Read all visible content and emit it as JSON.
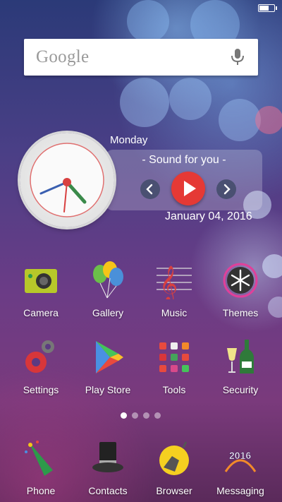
{
  "status_bar": {
    "battery_icon": "battery-icon"
  },
  "search": {
    "logo_text": "Google",
    "mic_icon": "mic-icon"
  },
  "clock_widget": {
    "day": "Monday",
    "music_title": "- Sound for you -",
    "date": "January 04, 2016",
    "play_icon": "play-icon",
    "prev_icon": "chevron-left-icon",
    "next_icon": "chevron-right-icon"
  },
  "apps": [
    {
      "label": "Camera",
      "icon": "camera-icon"
    },
    {
      "label": "Gallery",
      "icon": "balloons-icon"
    },
    {
      "label": "Music",
      "icon": "treble-clef-icon"
    },
    {
      "label": "Themes",
      "icon": "snowflake-icon"
    },
    {
      "label": "Settings",
      "icon": "gears-icon"
    },
    {
      "label": "Play Store",
      "icon": "play-store-icon"
    },
    {
      "label": "Tools",
      "icon": "tools-grid-icon"
    },
    {
      "label": "Security",
      "icon": "champagne-icon"
    }
  ],
  "page_indicator": {
    "count": 4,
    "active": 0
  },
  "dock": [
    {
      "label": "Phone",
      "icon": "party-popper-icon"
    },
    {
      "label": "Contacts",
      "icon": "top-hat-icon"
    },
    {
      "label": "Browser",
      "icon": "bomb-icon"
    },
    {
      "label": "Messaging",
      "icon": "happy-new-year-icon"
    }
  ],
  "colors": {
    "accent_red": "#e53935",
    "clock_face": "#eeeeee"
  }
}
